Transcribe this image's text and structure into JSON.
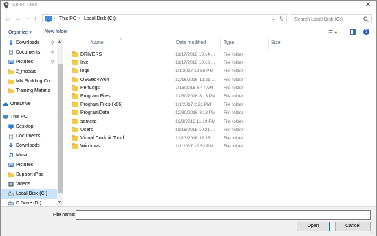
{
  "window": {
    "title": "Select Files",
    "close_glyph": "✕"
  },
  "nav": {
    "back_glyph": "←",
    "forward_glyph": "→",
    "recent_glyph": "⌄",
    "up_glyph": "↑",
    "address": {
      "crumbs": [
        "This PC",
        "Local Disk (C:)"
      ],
      "separator": "›",
      "dropdown_glyph": "⌄",
      "refresh_glyph": "↻"
    },
    "search": {
      "placeholder": "Search Local Disk (C:)"
    }
  },
  "toolbar": {
    "organize_label": "Organize ▾",
    "new_folder_label": "New folder",
    "view_glyph": "☰ ▾",
    "help_glyph": "?"
  },
  "sidebar": {
    "items": [
      {
        "label": "Downloads",
        "icon": "download-arrow-icon",
        "pinned": true
      },
      {
        "label": "Documents",
        "icon": "documents-icon",
        "pinned": true
      },
      {
        "label": "Pictures",
        "icon": "pictures-icon",
        "pinned": true
      },
      {
        "label": "2_mosaic",
        "icon": "folder-icon",
        "pinned": false
      },
      {
        "label": "MN Sodding Co",
        "icon": "folder-icon",
        "pinned": false
      },
      {
        "label": "Training Materia",
        "icon": "folder-icon",
        "pinned": false
      },
      {
        "label": "OneDrive",
        "icon": "cloud-icon",
        "pinned": false
      },
      {
        "label": "This PC",
        "icon": "computer-icon",
        "pinned": false
      },
      {
        "label": "Desktop",
        "icon": "desktop-icon",
        "pinned": false
      },
      {
        "label": "Documents",
        "icon": "documents-icon",
        "pinned": false
      },
      {
        "label": "Downloads",
        "icon": "download-arrow-icon",
        "pinned": false
      },
      {
        "label": "Music",
        "icon": "music-icon",
        "pinned": false
      },
      {
        "label": "Pictures",
        "icon": "pictures-icon",
        "pinned": false
      },
      {
        "label": "Support iPad",
        "icon": "ipad-icon",
        "pinned": false
      },
      {
        "label": "Videos",
        "icon": "videos-icon",
        "pinned": false
      },
      {
        "label": "Local Disk (C:)",
        "icon": "drive-icon",
        "pinned": false,
        "selected": true
      },
      {
        "label": "D Drive (D:)",
        "icon": "drive-icon",
        "pinned": false
      }
    ],
    "pin_glyph": "📌"
  },
  "filelist": {
    "columns": {
      "name": "Name",
      "date": "Date modified",
      "type": "Type",
      "size": "Size"
    },
    "sort_glyph": "^",
    "rows": [
      {
        "name": "DRIVERS",
        "date": "11/17/2016 10:14 ...",
        "type": "File folder"
      },
      {
        "name": "Intel",
        "date": "11/17/2016 10:16 ...",
        "type": "File folder"
      },
      {
        "name": "logs",
        "date": "1/1/2017 12:56 PM",
        "type": "File folder"
      },
      {
        "name": "OSGeo4W64",
        "date": "12/16/2016 12:21 ...",
        "type": "File folder"
      },
      {
        "name": "PerfLogs",
        "date": "7/16/2016 6:47 AM",
        "type": "File folder"
      },
      {
        "name": "Program Files",
        "date": "12/30/2016 8:13 PM",
        "type": "File folder"
      },
      {
        "name": "Program Files (x86)",
        "date": "1/1/2017 2:21 PM",
        "type": "File folder"
      },
      {
        "name": "ProgramData",
        "date": "12/30/2016 8:13 PM",
        "type": "File folder"
      },
      {
        "name": "sentera",
        "date": "12/9/2016 11:19 PM",
        "type": "File folder"
      },
      {
        "name": "Users",
        "date": "11/16/2016 10:21 ...",
        "type": "File folder"
      },
      {
        "name": "Virtual Cockpit Touch",
        "date": "12/13/2016 12:16 ...",
        "type": "File folder"
      },
      {
        "name": "Windows",
        "date": "1/1/2017 12:52 PM",
        "type": "File folder"
      }
    ]
  },
  "bottom": {
    "file_name_label": "File name:",
    "file_name_value": "",
    "dropdown_glyph": "⌄",
    "open_label": "Open",
    "cancel_label": "Cancel"
  },
  "colors": {
    "accent": "#0078d7",
    "selection": "#cce4f7",
    "folder": "#f5c94a"
  }
}
